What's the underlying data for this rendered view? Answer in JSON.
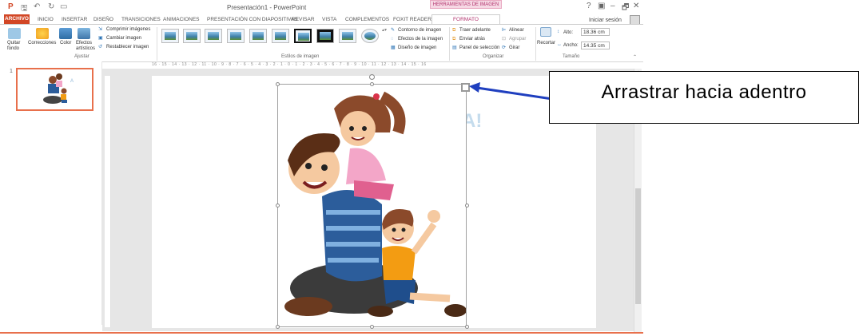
{
  "window": {
    "title": "Presentación1 - PowerPoint",
    "context_tab_title": "HERRAMIENTAS DE IMAGEN",
    "signin": "Iniciar sesión",
    "controls": [
      "?",
      "▣",
      "–",
      "🗗",
      "✕"
    ]
  },
  "tabs": [
    "INICIO",
    "INSERTAR",
    "DISEÑO",
    "TRANSICIONES",
    "ANIMACIONES",
    "PRESENTACIÓN CON DIAPOSITIVAS",
    "REVISAR",
    "VISTA",
    "COMPLEMENTOS",
    "FOXIT READER PDF"
  ],
  "tab_archivo": "ARCHIVO",
  "tab_formato": "FORMATO",
  "ribbon": {
    "ajustar": {
      "label": "Ajustar",
      "quitar_fondo": "Quitar fondo",
      "correcciones": "Correcciones",
      "color": "Color",
      "efectos": "Efectos artísticos",
      "comprimir": "Comprimir imágenes",
      "cambiar": "Cambiar imagen",
      "restablecer": "Restablecer imagen"
    },
    "estilos": {
      "label": "Estilos de imagen",
      "contorno": "Contorno de imagen",
      "efectos": "Efectos de la imagen",
      "diseno": "Diseño de imagen"
    },
    "organizar": {
      "label": "Organizar",
      "traer": "Traer adelante",
      "enviar": "Enviar atrás",
      "panel": "Panel de selección",
      "alinear": "Alinear",
      "agrupar": "Agrupar",
      "girar": "Girar"
    },
    "tamano": {
      "label": "Tamaño",
      "recortar": "Recortar",
      "alto_label": "Alto:",
      "alto_value": "18.36 cm",
      "ancho_label": "Ancho:",
      "ancho_value": "14.35 cm"
    }
  },
  "ruler": "16 · 15 · 14 · 13 · 12 · 11 · 10 · 9 · 8 · 7 · 6 · 5 · 4 · 3 · 2 · 1 · 0 · 1 · 2 · 3 · 4 · 5 · 6 · 7 · 8 · 9 · 10 · 11 · 12 · 13 · 14 · 15 · 16",
  "thumbnail": {
    "number": "1"
  },
  "slide": {
    "bg_text": "A!"
  },
  "callout": {
    "text": "Arrastrar hacia adentro"
  },
  "colors": {
    "archivo": "#d24726",
    "accent": "#b2346e",
    "arrow": "#1f3fbf"
  }
}
